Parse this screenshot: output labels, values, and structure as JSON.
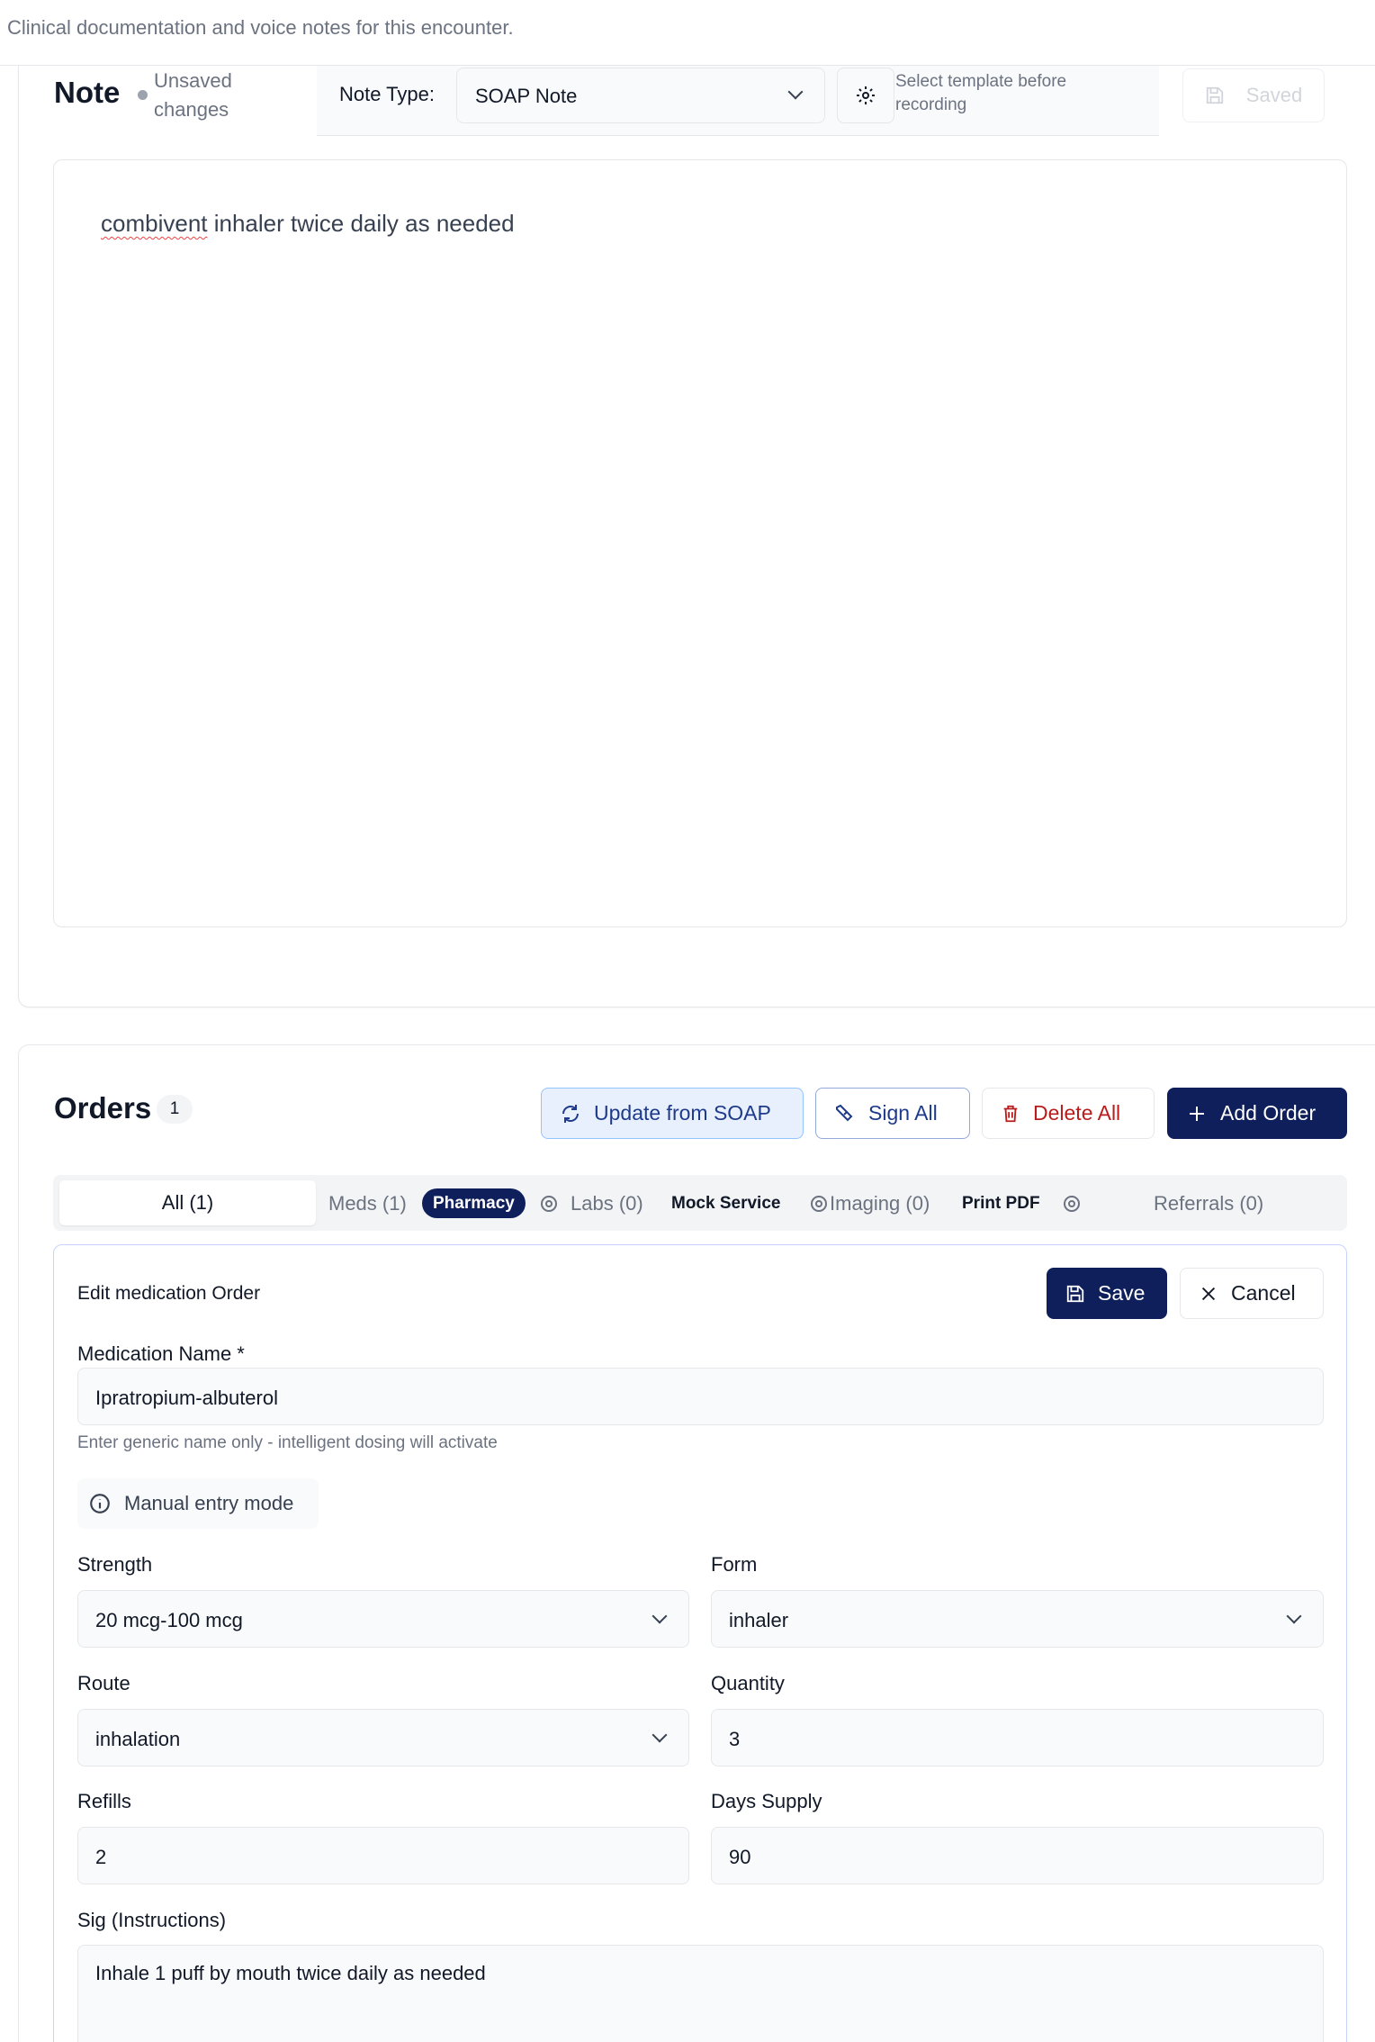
{
  "header": {
    "subtitle": "Clinical documentation and voice notes for this encounter."
  },
  "note": {
    "title": "Note",
    "status": "Unsaved changes",
    "type_label": "Note Type:",
    "type_value": "SOAP Note",
    "template_hint": "Select template before recording",
    "saved_label": "Saved",
    "content_word_misspelled": "combivent",
    "content_rest": " inhaler twice daily as needed"
  },
  "orders": {
    "title": "Orders",
    "count": "1",
    "buttons": {
      "update": "Update from SOAP",
      "sign": "Sign All",
      "delete": "Delete All",
      "add": "Add Order"
    },
    "tabs": {
      "all": "All (1)",
      "meds": "Meds (1)",
      "pharmacy": "Pharmacy",
      "labs": "Labs (0)",
      "mock_service": "Mock Service",
      "imaging": "Imaging (0)",
      "print_pdf": "Print PDF",
      "referrals": "Referrals (0)"
    }
  },
  "edit": {
    "title": "Edit medication Order",
    "save": "Save",
    "cancel": "Cancel",
    "medication_label": "Medication Name *",
    "medication_value": "Ipratropium-albuterol",
    "medication_help": "Enter generic name only - intelligent dosing will activate",
    "manual_mode": "Manual entry mode",
    "strength_label": "Strength",
    "strength_value": "20 mcg-100 mcg",
    "form_label": "Form",
    "form_value": "inhaler",
    "route_label": "Route",
    "route_value": "inhalation",
    "quantity_label": "Quantity",
    "quantity_value": "3",
    "refills_label": "Refills",
    "refills_value": "2",
    "days_label": "Days Supply",
    "days_value": "90",
    "sig_label": "Sig (Instructions)",
    "sig_value": "Inhale 1 puff by mouth twice daily as needed"
  },
  "icons": [
    "gear-icon",
    "save-icon",
    "refresh-icon",
    "pen-icon",
    "trash-icon",
    "plus-icon",
    "close-icon",
    "info-icon",
    "chevron-down-icon"
  ],
  "colors": {
    "primary": "#0f1f5c",
    "danger": "#b91c1c",
    "accent_light": "#e8f0fe"
  }
}
